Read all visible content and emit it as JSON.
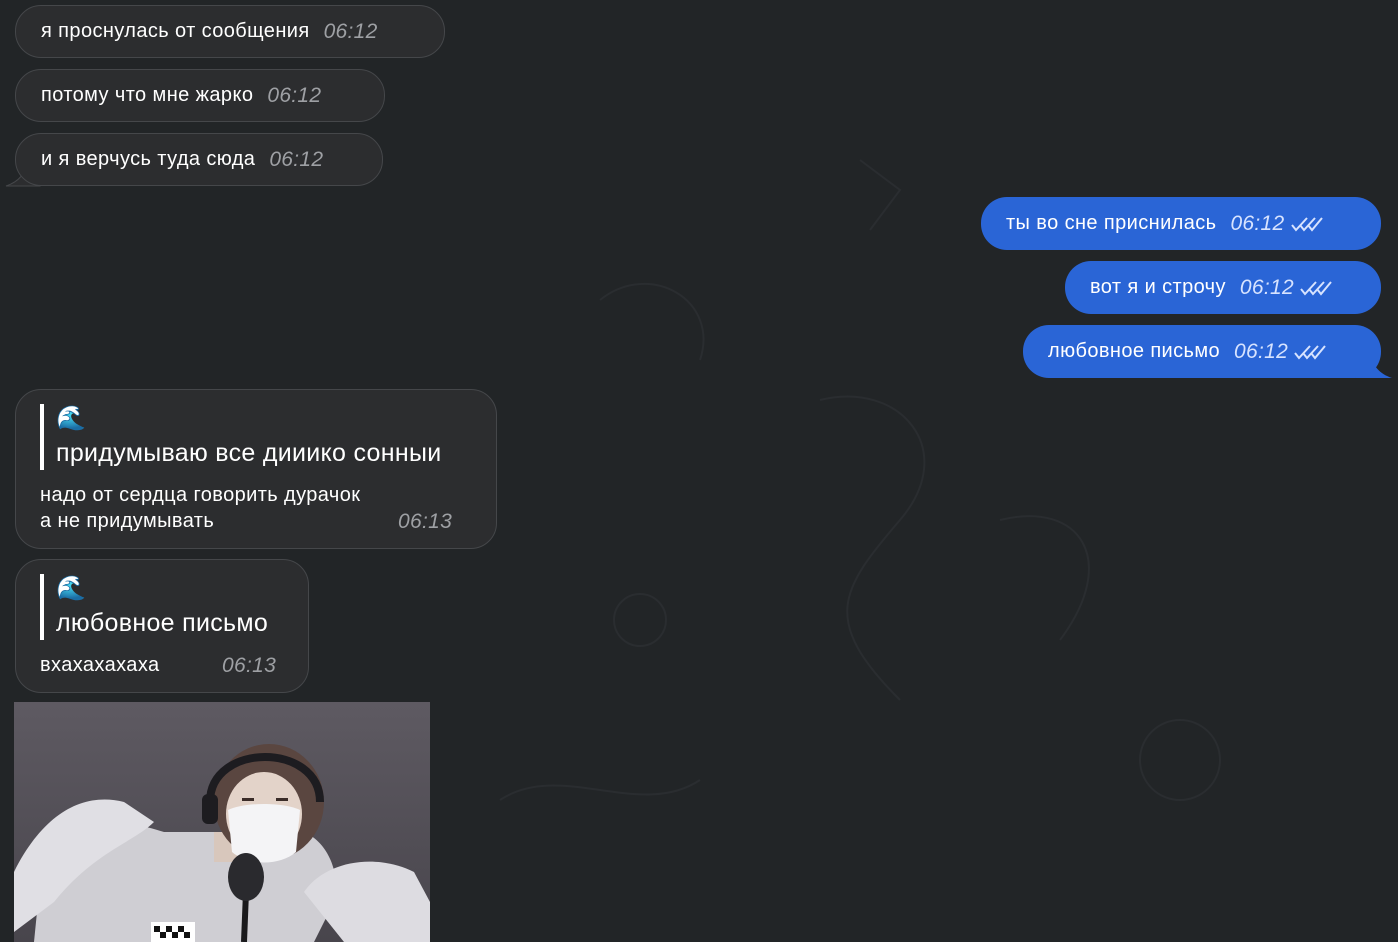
{
  "chat": {
    "incoming_top": [
      {
        "text": "я проснулась от сообщения",
        "time": "06:12"
      },
      {
        "text": "потому что мне жарко",
        "time": "06:12"
      },
      {
        "text": "и я верчусь туда сюда",
        "time": "06:12"
      }
    ],
    "outgoing": [
      {
        "text": "ты во сне приснилась",
        "time": "06:12",
        "status": "read-double-check-icon"
      },
      {
        "text": "вот я и строчу",
        "time": "06:12",
        "status": "read-double-check-icon"
      },
      {
        "text": "любовное письмо",
        "time": "06:12",
        "status": "read-double-check-icon"
      }
    ],
    "reply_messages": [
      {
        "quote_emoji": "🌊",
        "quote_text": "придумываю все дииико сонныи",
        "text_line1": "надо от сердца говорить дурачок",
        "text_line2": "а не придумывать",
        "time": "06:13"
      },
      {
        "quote_emoji": "🌊",
        "quote_text": "любовное письмо",
        "text_line1": "вхахахахаха",
        "time": "06:13"
      }
    ],
    "photo": {
      "description_icon": "photo-thumbnail"
    }
  },
  "colors": {
    "background": "#222527",
    "incoming_bubble": "#2c2d2f",
    "outgoing_bubble": "#2a65d6",
    "timestamp_incoming": "#9ea0a4"
  }
}
